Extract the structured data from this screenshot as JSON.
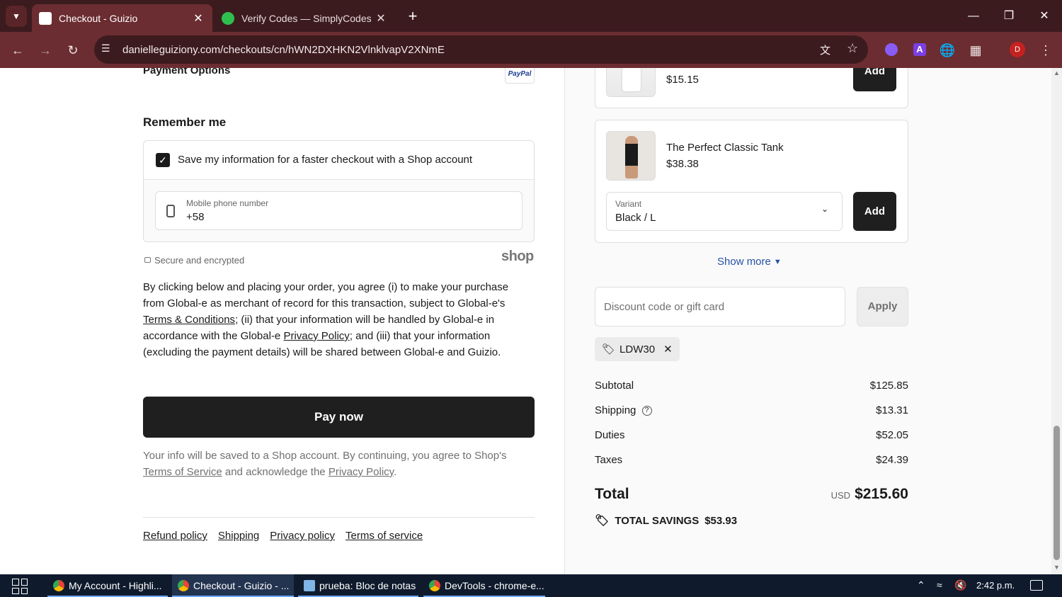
{
  "browser": {
    "tabs": [
      {
        "title": "Checkout - Guizio",
        "active": true
      },
      {
        "title": "Verify Codes — SimplyCodes",
        "active": false
      }
    ],
    "url": "danielleguiziony.com/checkouts/cn/hWN2DXHKN2VlnklvapV2XNmE",
    "profile_initial": "D",
    "accent_color": "#6b2d31",
    "tabstrip_color": "#3c1b1f"
  },
  "left": {
    "payment_options_label": "Payment Options",
    "paypal_badge": "PayPal",
    "remember_title": "Remember me",
    "save_info_label": "Save my information for a faster checkout with a Shop account",
    "save_info_checked": true,
    "phone_label": "Mobile phone number",
    "phone_value": "+58",
    "secure_label": "Secure and encrypted",
    "shop_logo": "shop",
    "legal": {
      "p1": "By clicking below and placing your order, you agree (i) to make your purchase from Global-e as merchant of record for this transaction, subject to Global-e's ",
      "terms_link": "Terms & Conditions",
      "p2": "; (ii) that your information will be handled by Global-e in accordance with the Global-e ",
      "privacy_link": "Privacy Policy",
      "p3": "; and (iii) that your information (excluding the payment details) will be shared between Global-e and Guizio."
    },
    "pay_button": "Pay now",
    "shop_notice": {
      "p1": "Your info will be saved to a Shop account. By continuing, you agree to Shop's ",
      "tos_link": "Terms of Service",
      "p2": " and acknowledge the ",
      "privacy_link": "Privacy Policy",
      "p3": "."
    },
    "footer_links": [
      "Refund policy",
      "Shipping",
      "Privacy policy",
      "Terms of service"
    ]
  },
  "right": {
    "upsell1": {
      "price": "$15.15",
      "add_label": "Add"
    },
    "upsell2": {
      "name": "The Perfect Classic Tank",
      "price": "$38.38",
      "variant_label": "Variant",
      "variant_value": "Black / L",
      "add_label": "Add"
    },
    "show_more": "Show more",
    "discount_placeholder": "Discount code or gift card",
    "apply_label": "Apply",
    "applied_code": "LDW30",
    "summary": [
      {
        "label": "Subtotal",
        "value": "$125.85"
      },
      {
        "label": "Shipping",
        "value": "$13.31"
      },
      {
        "label": "Duties",
        "value": "$52.05"
      },
      {
        "label": "Taxes",
        "value": "$24.39"
      }
    ],
    "total_label": "Total",
    "total_currency": "USD",
    "total_value": "$215.60",
    "savings_label": "TOTAL SAVINGS",
    "savings_value": "$53.93"
  },
  "taskbar": {
    "items": [
      {
        "label": "My Account - Highli...",
        "active": false
      },
      {
        "label": "Checkout - Guizio - ...",
        "active": true
      },
      {
        "label": "prueba: Bloc de notas",
        "active": false
      },
      {
        "label": "DevTools - chrome-e...",
        "active": false
      }
    ],
    "time": "2:42 p.m."
  }
}
